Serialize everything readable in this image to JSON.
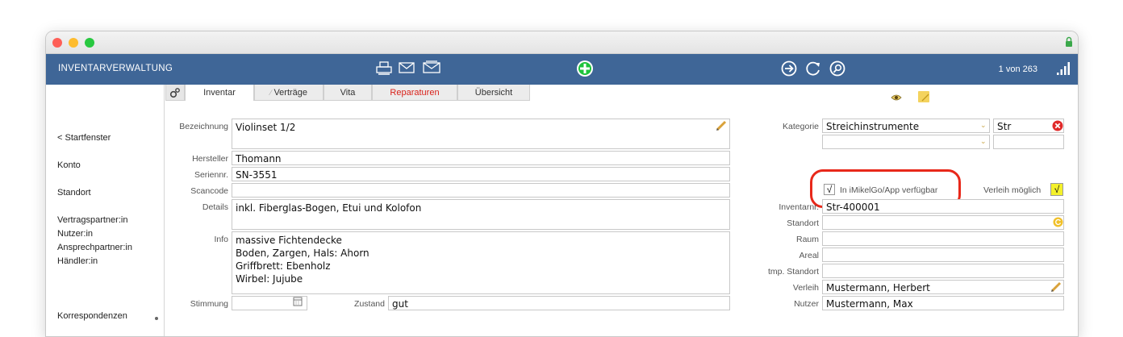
{
  "window": {
    "colors": {
      "toolbar": "#3f6697",
      "close": "#fe5f57",
      "minimize": "#febc2e",
      "zoom": "#28c840",
      "add": "#1ec33b",
      "error": "#e02a2a",
      "highlight": "#e8281a"
    }
  },
  "toolbar": {
    "title": "INVENTARVERWALTUNG",
    "icons": [
      "printer-icon",
      "envelope-icon",
      "envelope-open-icon",
      "add-icon",
      "forward-icon",
      "refresh-icon",
      "search-icon",
      "signal-icon"
    ],
    "record_counter": "1 von 263"
  },
  "sidebar": {
    "items": [
      {
        "label": "< Startfenster"
      },
      {
        "label": "Konto"
      },
      {
        "label": "Standort"
      },
      {
        "label": "Vertragspartner:in"
      },
      {
        "label": "Nutzer:in"
      },
      {
        "label": "Ansprechpartner:in"
      },
      {
        "label": "Händler:in"
      },
      {
        "label": "Korrespondenzen"
      }
    ]
  },
  "tabs": [
    {
      "label": "Inventar",
      "active": true
    },
    {
      "label": "Verträge",
      "active": false
    },
    {
      "label": "Vita",
      "active": false
    },
    {
      "label": "Reparaturen",
      "active": false,
      "color": "#d9221b"
    },
    {
      "label": "Übersicht",
      "active": false
    }
  ],
  "form_left": {
    "bezeichnung": {
      "label": "Bezeichnung",
      "value": "Violinset 1/2"
    },
    "hersteller": {
      "label": "Hersteller",
      "value": "Thomann"
    },
    "seriennr": {
      "label": "Seriennr.",
      "value": "SN-3551"
    },
    "scancode": {
      "label": "Scancode",
      "value": ""
    },
    "details": {
      "label": "Details",
      "value": "inkl. Fiberglas-Bogen, Etui und Kolofon"
    },
    "info": {
      "label": "Info",
      "value": "massive Fichtendecke\nBoden, Zargen, Hals: Ahorn\nGriffbrett: Ebenholz\nWirbel: Jujube"
    },
    "stimmung": {
      "label": "Stimmung",
      "value": ""
    },
    "zustand": {
      "label": "Zustand",
      "value": "gut"
    }
  },
  "form_right": {
    "kategorie": {
      "label": "Kategorie",
      "value": "Streichinstrumente",
      "code": "Str"
    },
    "app_checkbox": {
      "label": "In iMikelGo/App verfügbar",
      "checked": true,
      "mark": "√"
    },
    "verleih_checkbox": {
      "label": "Verleih möglich",
      "checked": true,
      "mark": "√"
    },
    "inventarnr": {
      "label": "Inventarnr.",
      "value": "Str-400001"
    },
    "standort": {
      "label": "Standort",
      "value": ""
    },
    "raum": {
      "label": "Raum",
      "value": ""
    },
    "areal": {
      "label": "Areal",
      "value": ""
    },
    "tmp_standort": {
      "label": "tmp. Standort",
      "value": ""
    },
    "verleih": {
      "label": "Verleih",
      "value": "Mustermann, Herbert"
    },
    "nutzer": {
      "label": "Nutzer",
      "value": "Mustermann, Max"
    }
  }
}
